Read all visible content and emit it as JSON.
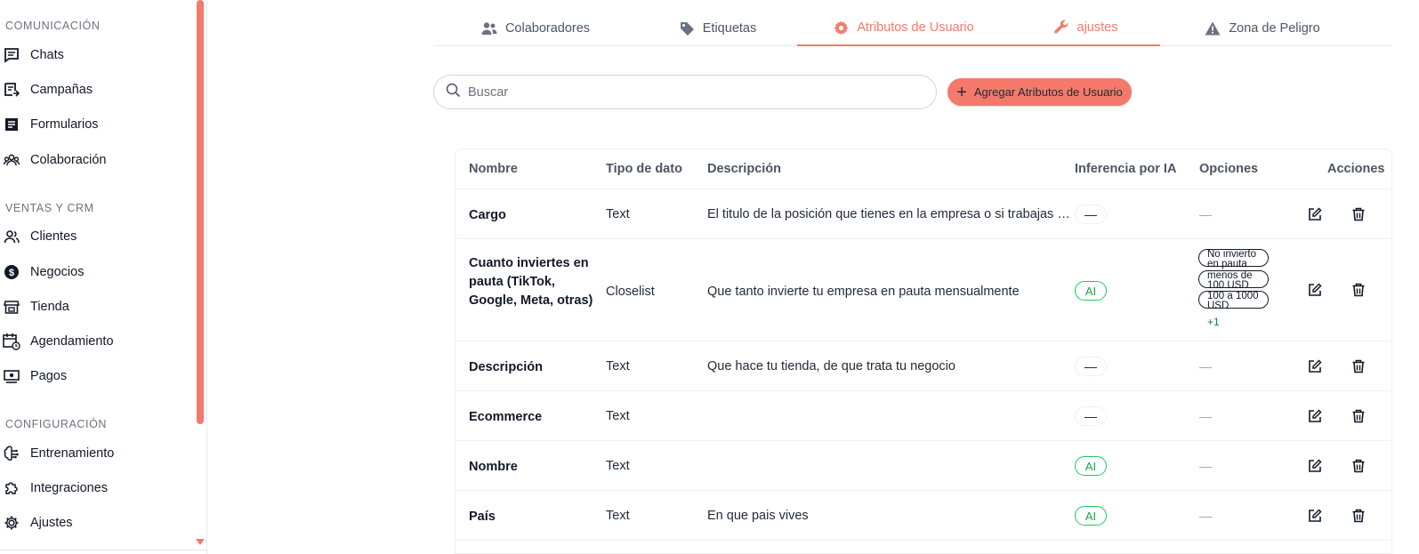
{
  "sidebar": {
    "sections": [
      {
        "title": "COMUNICACIÓN",
        "items": [
          {
            "label": "Chats",
            "icon": "chat-icon"
          },
          {
            "label": "Campañas",
            "icon": "campaign-icon"
          },
          {
            "label": "Formularios",
            "icon": "form-icon"
          },
          {
            "label": "Colaboración",
            "icon": "team-icon"
          }
        ]
      },
      {
        "title": "VENTAS Y CRM",
        "items": [
          {
            "label": "Clientes",
            "icon": "clients-icon"
          },
          {
            "label": "Negocios",
            "icon": "dollar-icon"
          },
          {
            "label": "Tienda",
            "icon": "store-icon"
          },
          {
            "label": "Agendamiento",
            "icon": "calendar-icon"
          },
          {
            "label": "Pagos",
            "icon": "payment-icon"
          }
        ]
      },
      {
        "title": "CONFIGURACIÓN",
        "items": [
          {
            "label": "Entrenamiento",
            "icon": "brain-icon"
          },
          {
            "label": "Integraciones",
            "icon": "puzzle-icon"
          },
          {
            "label": "Ajustes",
            "icon": "gear-icon"
          }
        ]
      }
    ]
  },
  "tabs": [
    {
      "label": "Colaboradores",
      "icon": "users-icon",
      "active": false
    },
    {
      "label": "Etiquetas",
      "icon": "tag-icon",
      "active": false
    },
    {
      "label": "Atributos de Usuario",
      "icon": "gear-icon",
      "active": true
    },
    {
      "label": "ajustes",
      "icon": "wrench-icon",
      "active": true
    },
    {
      "label": "Zona de Peligro",
      "icon": "warning-icon",
      "active": false
    }
  ],
  "search": {
    "placeholder": "Buscar",
    "value": ""
  },
  "add_button": {
    "label": "Agregar Atributos de Usuario"
  },
  "table": {
    "headers": [
      "Nombre",
      "Tipo de dato",
      "Descripción",
      "Inferencia por IA",
      "Opciones",
      "Acciones"
    ],
    "rows": [
      {
        "name": "Cargo",
        "type": "Text",
        "description": "El titulo de la posición que tienes en la empresa o si trabajas …",
        "ai": "—",
        "options": "—"
      },
      {
        "name": "Cuanto inviertes en pauta (TikTok, Google, Meta, otras)",
        "type": "Closelist",
        "description": "Que tanto invierte tu empresa en pauta mensualmente",
        "ai": "AI",
        "options_list": [
          "No invierto en pauta",
          "menos de 100 USD",
          "100 a 1000 USD"
        ],
        "options_more": "+1"
      },
      {
        "name": "Descripción",
        "type": "Text",
        "description": "Que hace tu tienda, de que trata tu negocio",
        "ai": "—",
        "options": "—"
      },
      {
        "name": "Ecommerce",
        "type": "Text",
        "description": "",
        "ai": "—",
        "options": "—"
      },
      {
        "name": "Nombre",
        "type": "Text",
        "description": "",
        "ai": "AI",
        "options": "—"
      },
      {
        "name": "País",
        "type": "Text",
        "description": "En que pais vives",
        "ai": "AI",
        "options": "—"
      }
    ]
  },
  "colors": {
    "accent": "#f4796a",
    "ai_green": "#22c55e"
  }
}
